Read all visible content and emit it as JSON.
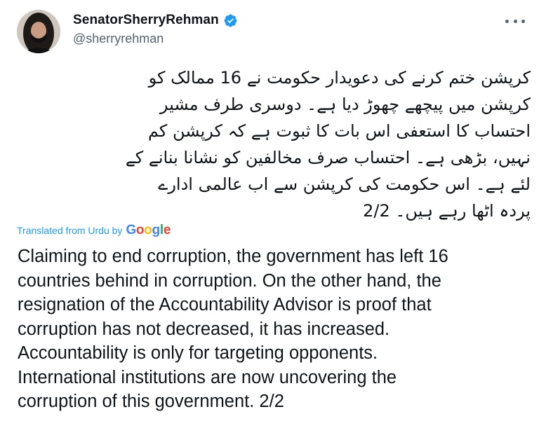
{
  "author": {
    "display_name": "SenatorSherryRehman",
    "handle": "@sherryrehman",
    "verified": true,
    "verified_color": "#1d9bf0"
  },
  "menu": {
    "icon": "more-horizontal-icon"
  },
  "tweet": {
    "urdu_lines": [
      "کرپشن ختم کرنے کی دعویدار حکومت نے 16 ممالک کو",
      "کرپشن میں پیچھے چھوڑ دیا ہے۔ دوسری طرف مشیر",
      "احتساب کا استعفی اس بات کا ثبوت ہے کہ کرپشن کم",
      "نہیں، بڑھی ہے۔ احتساب صرف مخالفین کو نشانا بنانے کے",
      "لئے ہے۔ اس حکومت کی کرپشن سے اب عالمی ادارے",
      "پردہ اٹھا رہے ہیں۔ 2/2"
    ],
    "translated_from": "Translated from Urdu by",
    "translator": "Google",
    "translation_lines": [
      "Claiming to end corruption, the government has left 16",
      "countries behind in corruption. On the other hand, the",
      "resignation of the Accountability Advisor is proof that",
      "corruption has not decreased, it has increased.",
      "Accountability is only for targeting opponents.",
      "International institutions are now uncovering the",
      "corruption of this government. 2/2"
    ]
  },
  "colors": {
    "accent": "#1d9bf0",
    "text": "#0f1419",
    "secondary": "#536471"
  }
}
